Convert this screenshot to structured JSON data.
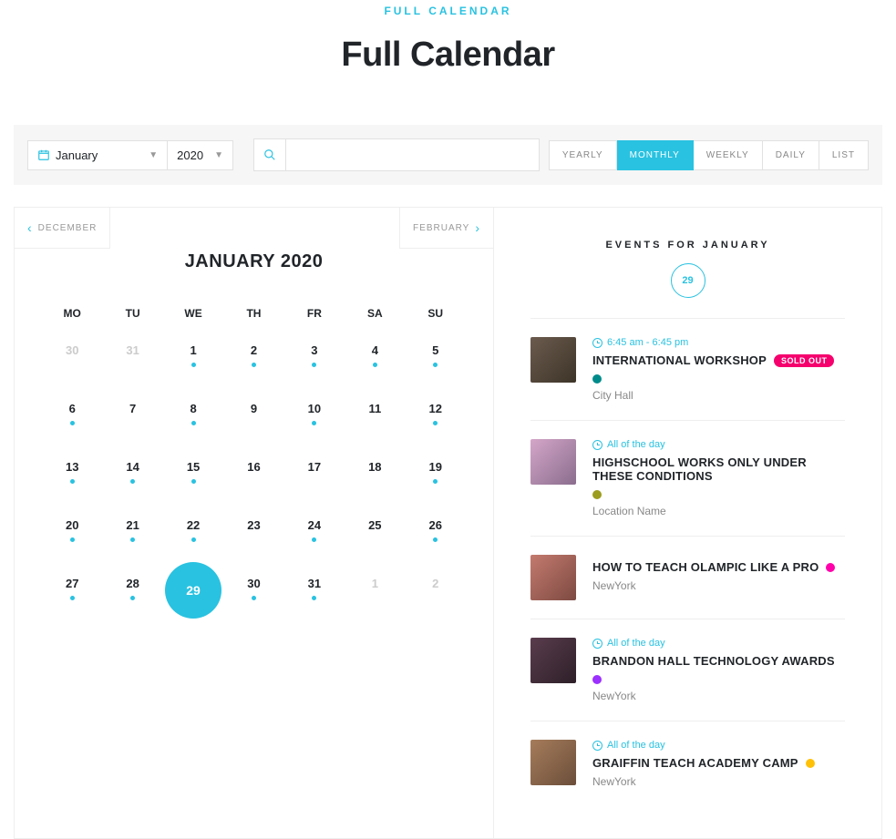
{
  "header": {
    "eyebrow": "FULL CALENDAR",
    "title": "Full Calendar"
  },
  "toolbar": {
    "month": "January",
    "year": "2020",
    "search_placeholder": "",
    "views": [
      "YEARLY",
      "MONTHLY",
      "WEEKLY",
      "DAILY",
      "LIST"
    ],
    "active_view": "MONTHLY"
  },
  "calendar": {
    "prev_label": "DECEMBER",
    "next_label": "FEBRUARY",
    "title": "JANUARY 2020",
    "weekdays": [
      "MO",
      "TU",
      "WE",
      "TH",
      "FR",
      "SA",
      "SU"
    ],
    "weeks": [
      [
        {
          "n": "30",
          "muted": true
        },
        {
          "n": "31",
          "muted": true
        },
        {
          "n": "1",
          "dot": true
        },
        {
          "n": "2",
          "dot": true
        },
        {
          "n": "3",
          "dot": true
        },
        {
          "n": "4",
          "dot": true
        },
        {
          "n": "5",
          "dot": true
        }
      ],
      [
        {
          "n": "6",
          "dot": true
        },
        {
          "n": "7"
        },
        {
          "n": "8",
          "dot": true
        },
        {
          "n": "9"
        },
        {
          "n": "10",
          "dot": true
        },
        {
          "n": "11"
        },
        {
          "n": "12",
          "dot": true
        }
      ],
      [
        {
          "n": "13",
          "dot": true
        },
        {
          "n": "14",
          "dot": true
        },
        {
          "n": "15",
          "dot": true
        },
        {
          "n": "16"
        },
        {
          "n": "17"
        },
        {
          "n": "18"
        },
        {
          "n": "19",
          "dot": true
        }
      ],
      [
        {
          "n": "20",
          "dot": true
        },
        {
          "n": "21",
          "dot": true
        },
        {
          "n": "22",
          "dot": true
        },
        {
          "n": "23"
        },
        {
          "n": "24",
          "dot": true
        },
        {
          "n": "25"
        },
        {
          "n": "26",
          "dot": true
        }
      ],
      [
        {
          "n": "27",
          "dot": true
        },
        {
          "n": "28",
          "dot": true
        },
        {
          "n": "29",
          "selected": true
        },
        {
          "n": "30",
          "dot": true
        },
        {
          "n": "31",
          "dot": true
        },
        {
          "n": "1",
          "muted": true
        },
        {
          "n": "2",
          "muted": true
        }
      ]
    ]
  },
  "events": {
    "title": "EVENTS FOR JANUARY",
    "day": "29",
    "items": [
      {
        "time": "6:45 am - 6:45 pm",
        "title": "INTERNATIONAL WORKSHOP",
        "badge": "SOLD OUT",
        "color": "#008b8b",
        "loc": "City Hall",
        "thumb": "thumb-1"
      },
      {
        "time": "All of the day",
        "title": "HIGHSCHOOL WORKS ONLY UNDER THESE CONDITIONS",
        "color": "#9c9c1f",
        "loc": "Location Name",
        "thumb": "thumb-2"
      },
      {
        "time": "",
        "title": "HOW TO TEACH OLAMPIC LIKE A PRO",
        "color": "#ff00aa",
        "loc": "NewYork",
        "thumb": "thumb-3"
      },
      {
        "time": "All of the day",
        "title": "BRANDON HALL TECHNOLOGY AWARDS",
        "color": "#9b30ff",
        "loc": "NewYork",
        "thumb": "thumb-4"
      },
      {
        "time": "All of the day",
        "title": "GRAIFFIN TEACH ACADEMY CAMP",
        "color": "#ffc107",
        "loc": "NewYork",
        "thumb": "thumb-5"
      }
    ]
  }
}
